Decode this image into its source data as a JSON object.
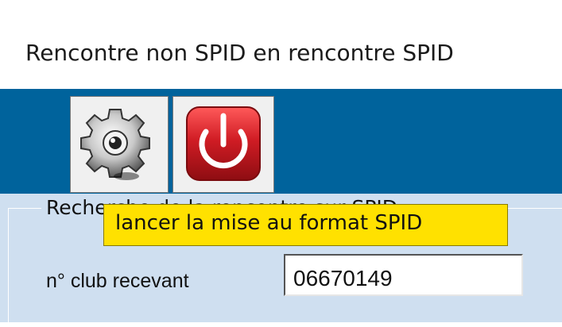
{
  "window": {
    "title": "Rencontre non SPID en rencontre SPID"
  },
  "toolbar": {
    "buttons": [
      {
        "icon": "gear-icon",
        "label": ""
      },
      {
        "icon": "power-icon",
        "label": ""
      }
    ],
    "tooltip": "lancer la mise au format SPID"
  },
  "search_group": {
    "legend": "Recherche de la rencontre sur SPID",
    "club_label": "n° club recevant",
    "club_value": "06670149"
  },
  "colors": {
    "toolbar_bg": "#00639c",
    "panel_bg": "#cfdff0",
    "tooltip_bg": "#ffe100",
    "power_red": "#d01c24"
  }
}
